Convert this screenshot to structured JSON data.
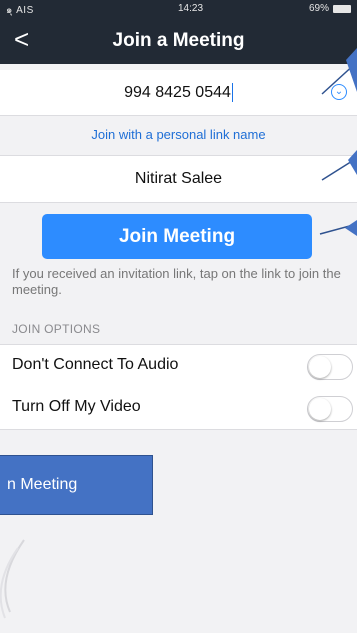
{
  "status_bar": {
    "carrier": "๑ุ AIS",
    "time": "14:23",
    "battery": "69%"
  },
  "header": {
    "back_label": "<",
    "title": "Join a Meeting"
  },
  "form": {
    "meeting_id": "994 8425 0544",
    "personal_link_label": "Join with a personal link name",
    "display_name": "Nitirat Salee",
    "join_button_label": "Join Meeting",
    "hint_text": "If you received an invitation link, tap on the link to join the meeting."
  },
  "join_options": {
    "section_title": "JOIN OPTIONS",
    "items": [
      {
        "label": "Don't Connect To Audio",
        "enabled": false
      },
      {
        "label": "Turn Off My Video",
        "enabled": false
      }
    ]
  },
  "annotation": {
    "callout_text": "n Meeting"
  },
  "colors": {
    "navbar_bg": "#222a35",
    "accent_blue": "#2d8cff",
    "link_blue": "#1f6fd6",
    "callout_fill": "#4472c4"
  }
}
